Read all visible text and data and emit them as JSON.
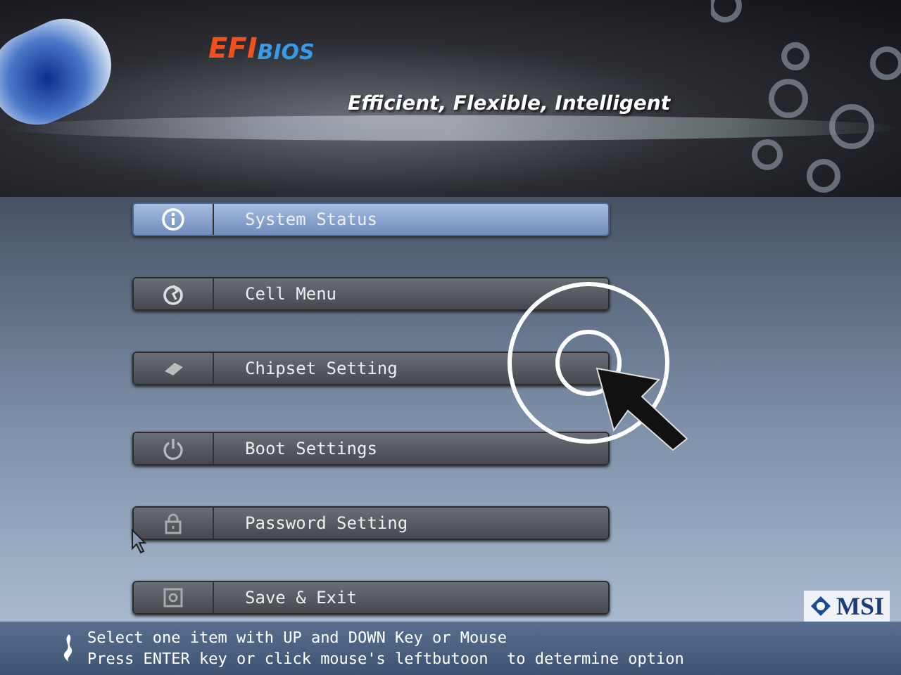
{
  "header": {
    "logo": [
      "EFI",
      "BIOS"
    ],
    "tagline": "Efficient, Flexible, Intelligent"
  },
  "menu": [
    {
      "label": "System Status",
      "selected": true
    },
    {
      "label": "Cell Menu",
      "selected": false
    },
    {
      "label": "Chipset Setting",
      "selected": false
    },
    {
      "label": "Boot Settings",
      "selected": false
    },
    {
      "label": "Password Setting",
      "selected": false
    },
    {
      "label": "Save & Exit",
      "selected": false
    }
  ],
  "brand": "MSI",
  "status_bar": [
    "Select one item with UP and DOWN Key or Mouse",
    "Press ENTER key or click mouse's leftbutoon  to determine option"
  ]
}
